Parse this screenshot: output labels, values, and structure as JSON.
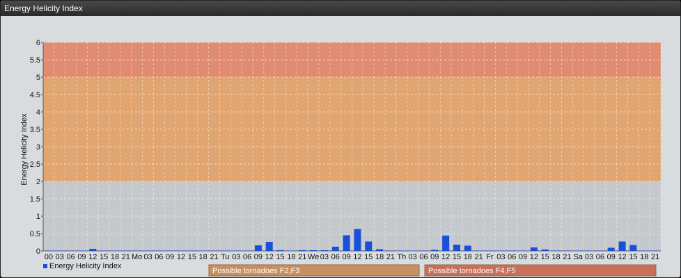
{
  "window": {
    "title": "Energy Helicity Index"
  },
  "chart_data": {
    "type": "bar",
    "ylabel": "Energy Helicity Index",
    "ylim": [
      0,
      6
    ],
    "yticks": [
      "0",
      "0.5",
      "1",
      "1.5",
      "2",
      "2.5",
      "3",
      "3.5",
      "4",
      "4.5",
      "5",
      "5.5",
      "6"
    ],
    "grid": true,
    "bands": [
      {
        "from": 0,
        "to": 2,
        "color": "#c5c8cc"
      },
      {
        "from": 2,
        "to": 5,
        "color": "#e0a570"
      },
      {
        "from": 5,
        "to": 6,
        "color": "#e08c72"
      }
    ],
    "categories": [
      "00",
      "03",
      "06",
      "09",
      "12",
      "15",
      "18",
      "21",
      "Mo",
      "03",
      "06",
      "09",
      "12",
      "15",
      "18",
      "21",
      "Tu",
      "03",
      "06",
      "09",
      "12",
      "15",
      "18",
      "21",
      "We",
      "03",
      "06",
      "09",
      "12",
      "15",
      "18",
      "21",
      "Th",
      "03",
      "06",
      "09",
      "12",
      "15",
      "18",
      "21",
      "Fr",
      "03",
      "06",
      "09",
      "12",
      "15",
      "18",
      "21",
      "Sa",
      "03",
      "06",
      "09",
      "12",
      "15",
      "18",
      "21"
    ],
    "series": [
      {
        "name": "Energy Helicity Index",
        "color": "#1a4fd8",
        "values": [
          0.01,
          0.01,
          0.01,
          0.01,
          0.06,
          0.01,
          0.01,
          0.01,
          0.01,
          0.01,
          0.01,
          0.01,
          0.01,
          0.01,
          0.01,
          0.01,
          0.01,
          0.01,
          0.01,
          0.16,
          0.26,
          0.02,
          0.01,
          0.02,
          0.02,
          0.02,
          0.12,
          0.45,
          0.63,
          0.27,
          0.05,
          0.01,
          0.01,
          0.01,
          0.01,
          0.03,
          0.44,
          0.18,
          0.15,
          0.01,
          0.01,
          0.01,
          0.01,
          0.01,
          0.1,
          0.04,
          0.01,
          0.01,
          0.01,
          0.01,
          0.01,
          0.09,
          0.27,
          0.17,
          0.01,
          0.01
        ]
      }
    ],
    "legend": {
      "position": "bottom-left",
      "label": "Energy Helicity Index"
    },
    "annotations": [
      {
        "label": "Possible tornadoes F2,F3",
        "color": "#c89060"
      },
      {
        "label": "Possible tornadoes F4,F5",
        "color": "#c8705a"
      }
    ]
  }
}
